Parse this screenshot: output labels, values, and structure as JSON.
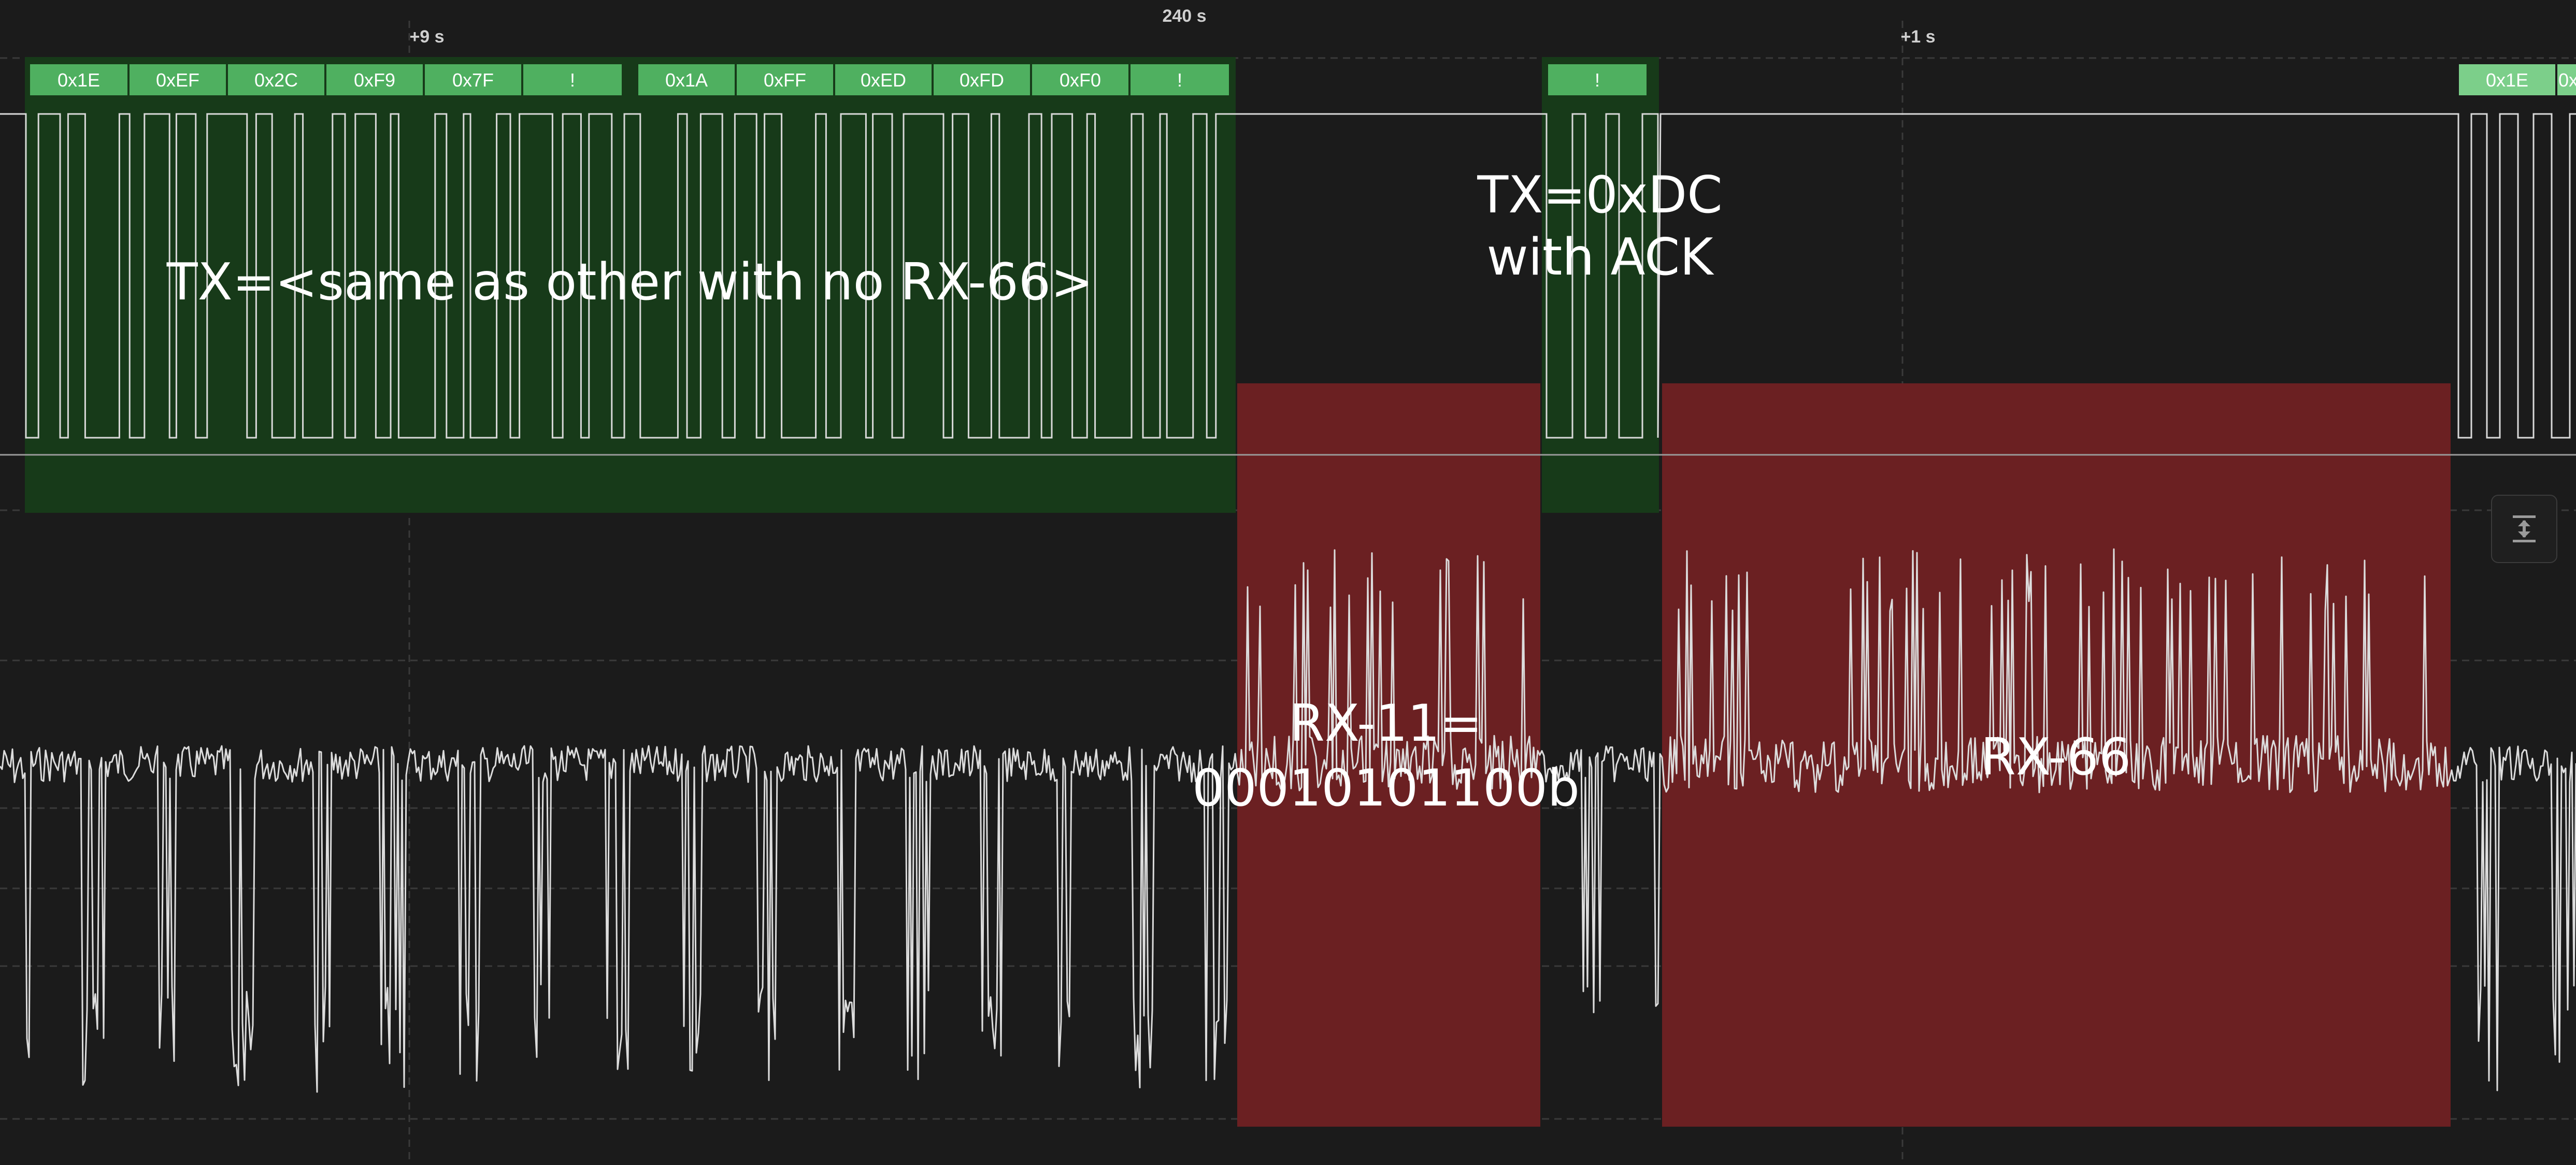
{
  "colors": {
    "background": "#1b1b1b",
    "tx_highlight": "#173a19",
    "rx_highlight": "#6b2022",
    "byte_label": "#4fb060",
    "byte_label_faded": "#7ccf8a",
    "digital_trace": "#d9d9d9",
    "analog_trace": "#dcdcdc",
    "gridline": "#3a3a3a"
  },
  "timeline": {
    "marker_start": "+9 s",
    "marker_center": "240 s",
    "marker_end": "+1 s"
  },
  "decoder": {
    "bytes_group_a": [
      "0x1E",
      "0xEF",
      "0x2C",
      "0xF9",
      "0x7F",
      "!"
    ],
    "bytes_group_b": [
      "0x1A",
      "0xFF",
      "0xED",
      "0xFD",
      "0xF0",
      "!"
    ],
    "bytes_group_c": [
      "!"
    ],
    "bytes_group_d": [
      "0x1E",
      "0x"
    ]
  },
  "annotations": {
    "tx_main": "TX=<same as other with no RX-66>",
    "tx_ack_line1": "TX=0xDC",
    "tx_ack_line2": "with ACK",
    "rx11_line1": "RX-11=",
    "rx11_line2": "00010101100b",
    "rx66": "RX-66"
  },
  "controls": {
    "fit_icon": "fit-height-icon"
  }
}
